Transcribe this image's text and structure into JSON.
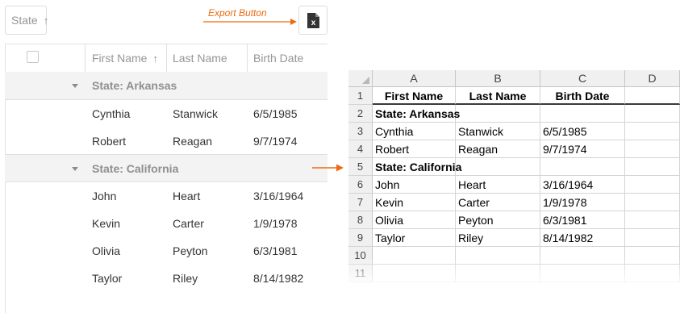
{
  "grid": {
    "group_panel": {
      "label": "State",
      "sort_icon": "arrow-up-icon"
    },
    "export_callout": "Export Button",
    "export_icon": "excel-export-icon",
    "columns": [
      {
        "label": "First Name",
        "sort_icon": "arrow-up-icon"
      },
      {
        "label": "Last Name"
      },
      {
        "label": "Birth Date"
      }
    ],
    "groups": [
      {
        "label": "State: Arkansas",
        "rows": [
          [
            "Cynthia",
            "Stanwick",
            "6/5/1985"
          ],
          [
            "Robert",
            "Reagan",
            "9/7/1974"
          ]
        ]
      },
      {
        "label": "State: California",
        "rows": [
          [
            "John",
            "Heart",
            "3/16/1964"
          ],
          [
            "Kevin",
            "Carter",
            "1/9/1978"
          ],
          [
            "Olivia",
            "Peyton",
            "6/3/1981"
          ],
          [
            "Taylor",
            "Riley",
            "8/14/1982"
          ]
        ]
      }
    ]
  },
  "sheet": {
    "col_headers": [
      "A",
      "B",
      "C",
      "D"
    ],
    "row_numbers": [
      "1",
      "2",
      "3",
      "4",
      "5",
      "6",
      "7",
      "8",
      "9",
      "10",
      "11"
    ],
    "rows": [
      {
        "cells": [
          "First Name",
          "Last Name",
          "Birth Date"
        ],
        "bold": true,
        "center": true
      },
      {
        "cells": [
          "State: Arkansas",
          "",
          ""
        ],
        "bold": true
      },
      {
        "cells": [
          "Cynthia",
          "Stanwick",
          "6/5/1985"
        ]
      },
      {
        "cells": [
          "Robert",
          "Reagan",
          "9/7/1974"
        ]
      },
      {
        "cells": [
          "State: California",
          "",
          ""
        ],
        "bold": true
      },
      {
        "cells": [
          "John",
          "Heart",
          "3/16/1964"
        ]
      },
      {
        "cells": [
          "Kevin",
          "Carter",
          "1/9/1978"
        ]
      },
      {
        "cells": [
          "Olivia",
          "Peyton",
          "6/3/1981"
        ]
      },
      {
        "cells": [
          "Taylor",
          "Riley",
          "8/14/1982"
        ]
      },
      {
        "cells": [
          "",
          "",
          ""
        ]
      },
      {
        "cells": [
          "",
          "",
          ""
        ]
      }
    ]
  },
  "colors": {
    "accent": "#ea6c12",
    "group_bg": "#f3f3f3",
    "border": "#e0e0e0"
  }
}
